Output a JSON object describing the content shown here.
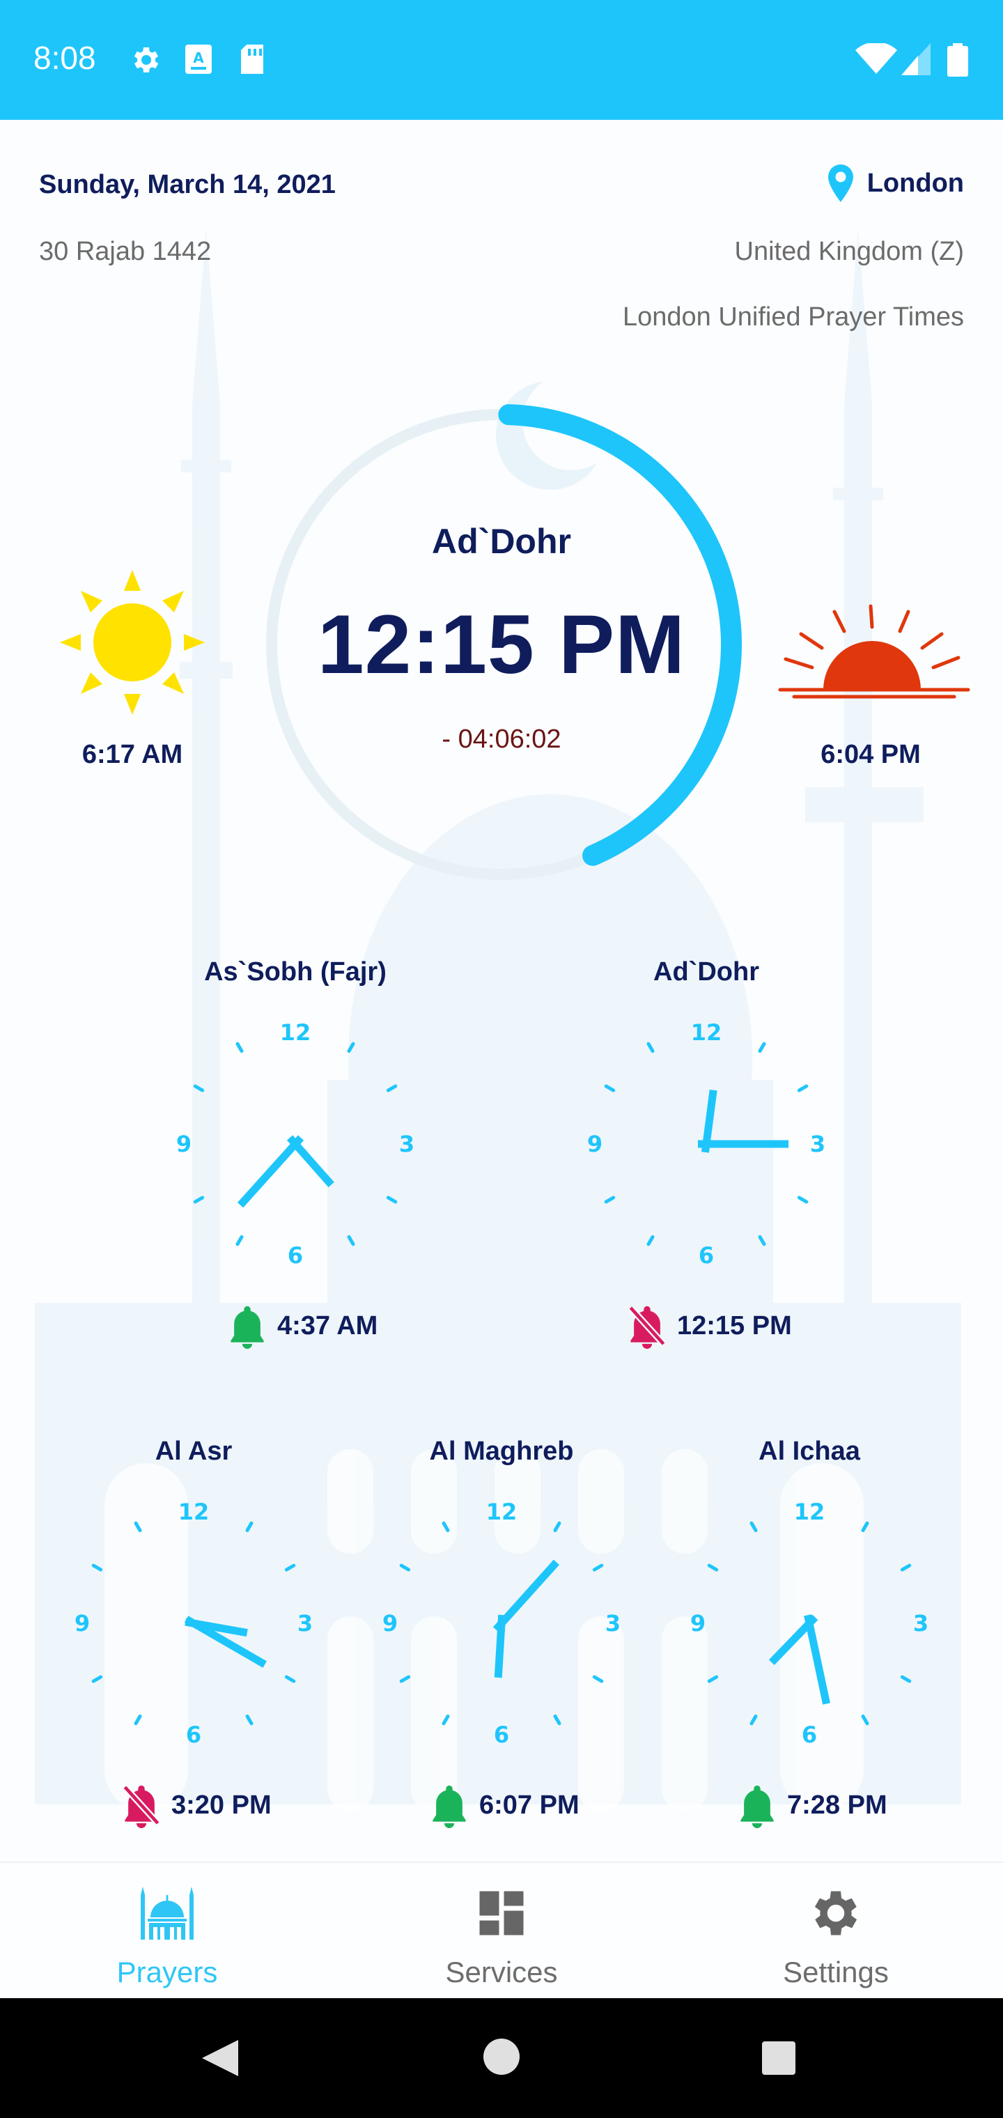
{
  "status_bar": {
    "time": "8:08",
    "left_icons": [
      "settings-icon",
      "keyboard-icon",
      "sd-card-icon"
    ],
    "right_icons": [
      "wifi-icon",
      "signal-icon",
      "battery-icon"
    ],
    "color": "#1ec5fb"
  },
  "header": {
    "date": "Sunday, March 14, 2021",
    "hijri_date": "30 Rajab 1442",
    "city": "London",
    "country": "United Kingdom (Z)",
    "method": "London Unified Prayer Times"
  },
  "current": {
    "name": "Ad`Dohr",
    "time": "12:15 PM",
    "countdown": "- 04:06:02",
    "progress": 0.43
  },
  "sunrise": {
    "icon": "sun-icon",
    "time": "6:17 AM"
  },
  "sunset": {
    "icon": "sunset-icon",
    "time": "6:04 PM"
  },
  "clock_numbers": {
    "n12": "12",
    "n3": "3",
    "n6": "6",
    "n9": "9"
  },
  "prayers": [
    {
      "name": "As`Sobh (Fajr)",
      "time": "4:37 AM",
      "alarm": "on"
    },
    {
      "name": "Ad`Dohr",
      "time": "12:15 PM",
      "alarm": "off"
    },
    {
      "name": "Al Asr",
      "time": "3:20 PM",
      "alarm": "off"
    },
    {
      "name": "Al Maghreb",
      "time": "6:07 PM",
      "alarm": "on"
    },
    {
      "name": "Al Ichaa",
      "time": "7:28 PM",
      "alarm": "on"
    }
  ],
  "nav": {
    "prayers": "Prayers",
    "services": "Services",
    "settings": "Settings"
  },
  "colors": {
    "accent": "#1ec5fb",
    "navy": "#0f1d5c",
    "alarm_on": "#1bb35a",
    "alarm_off": "#d81b60",
    "sun": "#ffe200",
    "sunset": "#e8390e"
  }
}
